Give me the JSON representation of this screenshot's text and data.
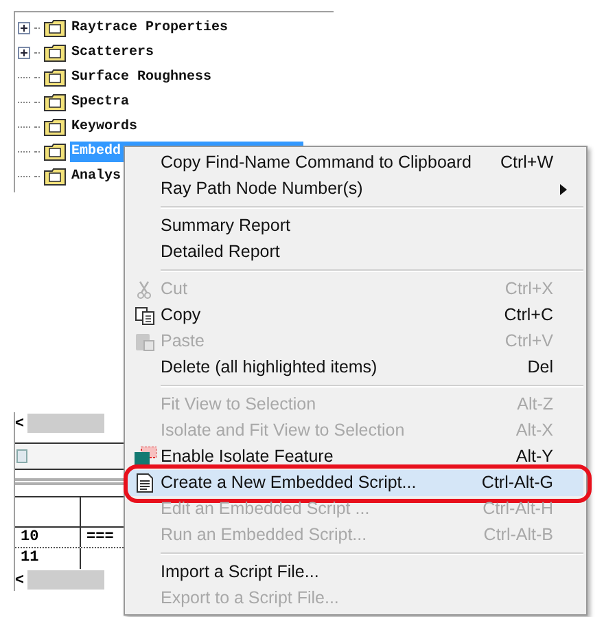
{
  "tree": {
    "items": [
      {
        "label": "Raytrace Properties",
        "expandable": true,
        "selected": false
      },
      {
        "label": "Scatterers",
        "expandable": true,
        "selected": false
      },
      {
        "label": "Surface Roughness",
        "expandable": false,
        "selected": false
      },
      {
        "label": "Spectra",
        "expandable": false,
        "selected": false
      },
      {
        "label": "Keywords",
        "expandable": false,
        "selected": false
      },
      {
        "label": "Embedd",
        "expandable": false,
        "selected": true
      },
      {
        "label": "Analys",
        "expandable": false,
        "selected": false
      }
    ]
  },
  "lower_panel": {
    "scroll_left": "<",
    "table": {
      "rows": [
        [
          "10",
          "==="
        ],
        [
          "11",
          ""
        ]
      ]
    },
    "table_scroll_left": "<"
  },
  "context_menu": {
    "items": [
      {
        "kind": "item",
        "label": "Copy Find-Name Command to Clipboard",
        "shortcut": "Ctrl+W",
        "disabled": false,
        "selected": false
      },
      {
        "kind": "submenu",
        "label": "Ray Path Node Number(s)",
        "disabled": false,
        "selected": false
      },
      {
        "kind": "separator"
      },
      {
        "kind": "item",
        "label": "Summary Report",
        "disabled": false,
        "selected": false
      },
      {
        "kind": "item",
        "label": "Detailed Report",
        "disabled": false,
        "selected": false
      },
      {
        "kind": "separator"
      },
      {
        "kind": "item",
        "label": "Cut",
        "shortcut": "Ctrl+X",
        "disabled": true,
        "selected": false
      },
      {
        "kind": "item",
        "label": "Copy",
        "shortcut": "Ctrl+C",
        "disabled": false,
        "selected": false
      },
      {
        "kind": "item",
        "label": "Paste",
        "shortcut": "Ctrl+V",
        "disabled": true,
        "selected": false
      },
      {
        "kind": "item",
        "label": "Delete (all highlighted items)",
        "shortcut": "Del",
        "disabled": false,
        "selected": false
      },
      {
        "kind": "separator"
      },
      {
        "kind": "item",
        "label": "Fit View to Selection",
        "shortcut": "Alt-Z",
        "disabled": true,
        "selected": false
      },
      {
        "kind": "item",
        "label": "Isolate and Fit View to Selection",
        "shortcut": "Alt-X",
        "disabled": true,
        "selected": false
      },
      {
        "kind": "item",
        "label": "Enable Isolate Feature",
        "shortcut": "Alt-Y",
        "disabled": false,
        "selected": false
      },
      {
        "kind": "item",
        "label": "Create a New Embedded Script...",
        "shortcut": "Ctrl-Alt-G",
        "disabled": false,
        "selected": true,
        "circled": true
      },
      {
        "kind": "item",
        "label": "Edit an Embedded Script ...",
        "shortcut": "Ctrl-Alt-H",
        "disabled": true,
        "selected": false
      },
      {
        "kind": "item",
        "label": "Run an Embedded Script...",
        "shortcut": "Ctrl-Alt-B",
        "disabled": true,
        "selected": false
      },
      {
        "kind": "separator"
      },
      {
        "kind": "item",
        "label": "Import a Script File...",
        "disabled": false,
        "selected": false
      },
      {
        "kind": "item",
        "label": "Export to a Script File...",
        "disabled": true,
        "selected": false
      }
    ]
  }
}
